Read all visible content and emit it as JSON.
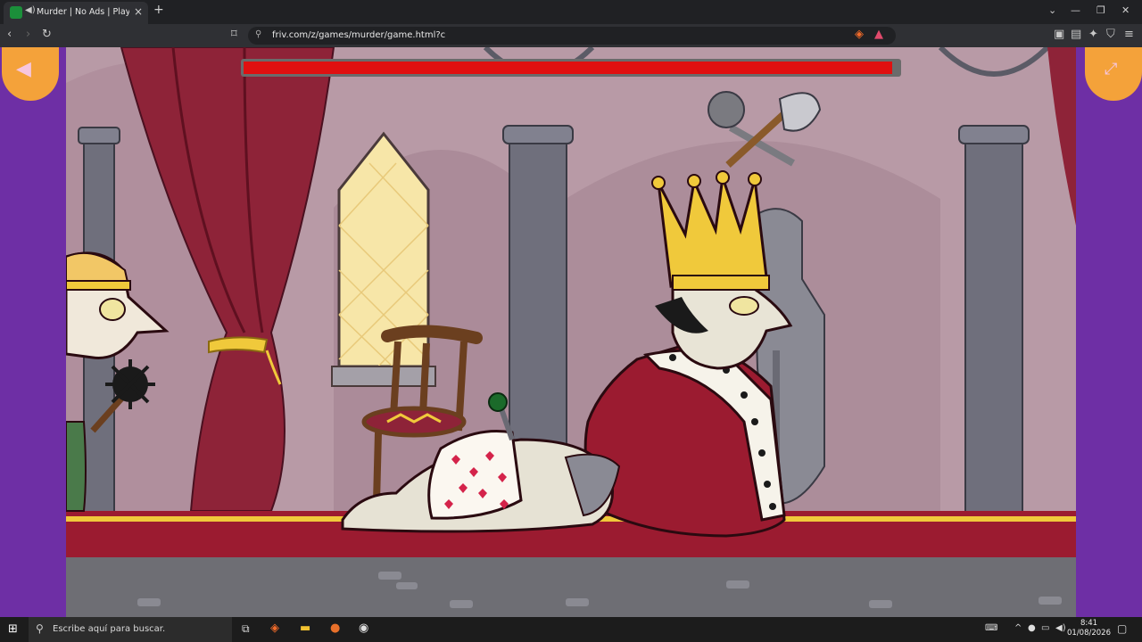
{
  "browser": {
    "tab": {
      "title": "Murder | No Ads | Play At Friv",
      "close_icon": "×",
      "new_tab_icon": "+"
    },
    "url": "friv.com/z/games/murder/game.html?c"
  },
  "game": {
    "health_bar": {
      "fraction": 0.99,
      "color": "#e01010"
    },
    "colors": {
      "wall": "#b89aa6",
      "floor": "#9b1b30",
      "curtain": "#8e2338",
      "crown": "#f0c93b",
      "side_panel": "#6e2fa5",
      "corner_button": "#f4a23a"
    }
  },
  "taskbar": {
    "search_placeholder": "Escribe aquí para buscar.",
    "time": "8:41",
    "date": "01/08/2026"
  }
}
